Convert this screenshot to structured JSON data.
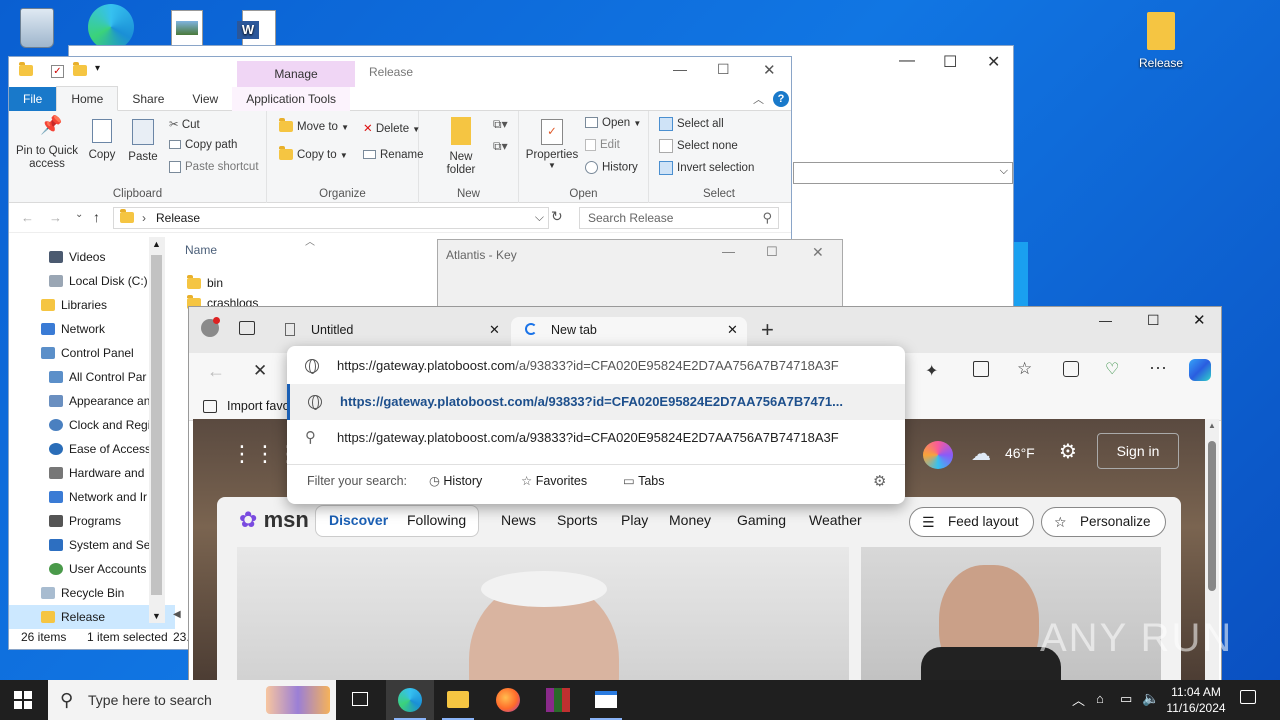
{
  "desktop": {
    "release_icon": "Release"
  },
  "win2": {
    "title": ""
  },
  "explorer": {
    "quick_access": [
      "folder-icon",
      "checkbox-icon",
      "folder-icon"
    ],
    "ribbon_context_tab": "Manage",
    "title": "Release",
    "tabs": [
      "File",
      "Home",
      "Share",
      "View",
      "Application Tools"
    ],
    "clipboard": {
      "pin": "Pin to Quick access",
      "copy": "Copy",
      "paste": "Paste",
      "cut": "Cut",
      "copy_path": "Copy path",
      "paste_shortcut": "Paste shortcut",
      "label": "Clipboard"
    },
    "organize": {
      "move_to": "Move to",
      "copy_to": "Copy to",
      "delete": "Delete",
      "rename": "Rename",
      "label": "Organize"
    },
    "new": {
      "new_folder": "New folder",
      "label": "New"
    },
    "open": {
      "properties": "Properties",
      "open": "Open",
      "edit": "Edit",
      "history": "History",
      "label": "Open"
    },
    "select": {
      "select_all": "Select all",
      "select_none": "Select none",
      "invert": "Invert selection",
      "label": "Select"
    },
    "address": "Release",
    "search_placeholder": "Search Release",
    "nav_items": [
      "Videos",
      "Local Disk (C:)",
      "Libraries",
      "Network",
      "Control Panel",
      "All Control Par",
      "Appearance an",
      "Clock and Regi",
      "Ease of Access",
      "Hardware and",
      "Network and Ir",
      "Programs",
      "System and Se",
      "User Accounts",
      "Recycle Bin",
      "Release"
    ],
    "column_name": "Name",
    "files": [
      "bin",
      "crashlogs"
    ],
    "status": {
      "count": "26 items",
      "selected": "1 item selected",
      "size": "23."
    }
  },
  "atlantis": {
    "title": "Atlantis - Key"
  },
  "edge": {
    "tabs": [
      "Untitled",
      "New tab"
    ],
    "import_favorites": "Import favo",
    "suggestions": [
      {
        "prefix": "https://gateway.platoboost.com",
        "rest": "/a/93833?id=CFA020E95824E2D7AA756A7B74718A3F"
      },
      {
        "text": "https://gateway.platoboost.com/a/93833?id=CFA020E95824E2D7AA756A7B7471..."
      },
      {
        "text": "https://gateway.platoboost.com/a/93833?id=CFA020E95824E2D7AA756A7B74718A3F"
      }
    ],
    "filter_label": "Filter your search:",
    "filters": [
      "History",
      "Favorites",
      "Tabs"
    ],
    "weather": "46°F",
    "sign_in": "Sign in",
    "msn": {
      "logo": "msn",
      "nav": [
        "Discover",
        "Following",
        "News",
        "Sports",
        "Play",
        "Money",
        "Gaming",
        "Weather"
      ],
      "feed_layout": "Feed layout",
      "personalize": "Personalize"
    }
  },
  "taskbar": {
    "search_placeholder": "Type here to search",
    "time": "11:04 AM",
    "date": "11/16/2024"
  },
  "watermark": "ANY RUN"
}
